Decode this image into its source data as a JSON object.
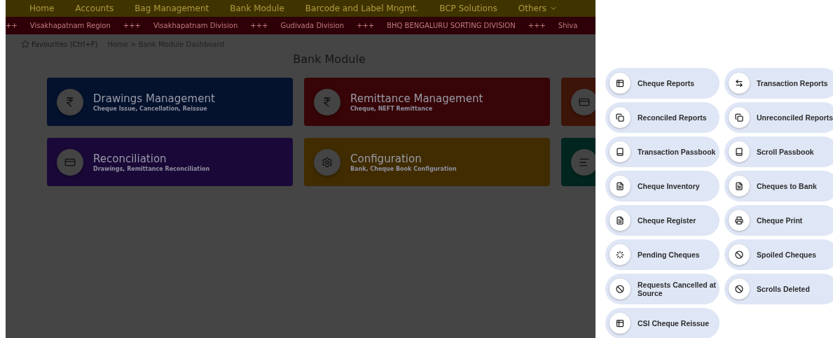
{
  "nav": {
    "items": [
      "Home",
      "Accounts",
      "Bag Management",
      "Bank Module",
      "Barcode and Label Mngmt.",
      "BCP Solutions",
      "Others"
    ]
  },
  "ticker": [
    "++",
    "Visakhapatnam Region",
    "+++",
    "Visakhapatnam Division",
    "+++",
    "Gudivada Division",
    "+++",
    "BHQ BENGALURU SORTING DIVISION",
    "+++",
    "Shiva"
  ],
  "favourites": "Favourites (Ctrl+F)",
  "breadcrumb": "Home > Bank Module Dashboard",
  "page_title": "Bank Module",
  "cards": [
    {
      "title": "Drawings Management",
      "subtitle": "Cheque Issue, Cancellation, Reissue",
      "color": "#04122e"
    },
    {
      "title": "Remittance Management",
      "subtitle": "Cheque, NEFT Remittance",
      "color": "#370507"
    },
    {
      "color": "#3d1408"
    },
    {
      "title": "Reconciliation",
      "subtitle": "Drawings, Remittance Reconciliation",
      "color": "#1a0938"
    },
    {
      "title": "Configuration",
      "subtitle": "Bank, Cheque Book Configuration",
      "color": "#402c00"
    },
    {
      "color": "#00261f"
    }
  ],
  "menu": [
    {
      "label": "Cheque Reports"
    },
    {
      "label": "Transaction Reports"
    },
    {
      "label": "Reconciled Reports"
    },
    {
      "label": "Unreconciled Reports"
    },
    {
      "label": "Transaction Passbook"
    },
    {
      "label": "Scroll Passbook"
    },
    {
      "label": "Cheque Inventory"
    },
    {
      "label": "Cheques to Bank"
    },
    {
      "label": "Cheque Register"
    },
    {
      "label": "Cheque Print"
    },
    {
      "label": "Pending Cheques"
    },
    {
      "label": "Spoiled Cheques"
    },
    {
      "label": "Requests Cancelled at Source"
    },
    {
      "label": "Scrolls Deleted"
    },
    {
      "label": "CSI Cheque Reissue"
    }
  ]
}
